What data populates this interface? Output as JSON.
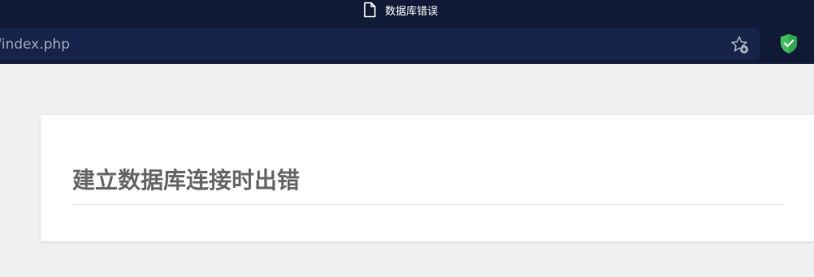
{
  "browser": {
    "tab_title": "数据库错误",
    "url": "/index.php",
    "colors": {
      "chrome_background": "#101a36",
      "urlbar_background": "#17244a",
      "shield_accent": "#3fbf5f"
    },
    "icons": {
      "tab": "page-icon",
      "bookmark": "star-plus-icon",
      "extension": "shield-check-icon"
    }
  },
  "page": {
    "error_heading": "建立数据库连接时出错",
    "colors": {
      "page_background": "#f0f0f0",
      "card_background": "#ffffff",
      "heading_text": "#666666"
    }
  }
}
